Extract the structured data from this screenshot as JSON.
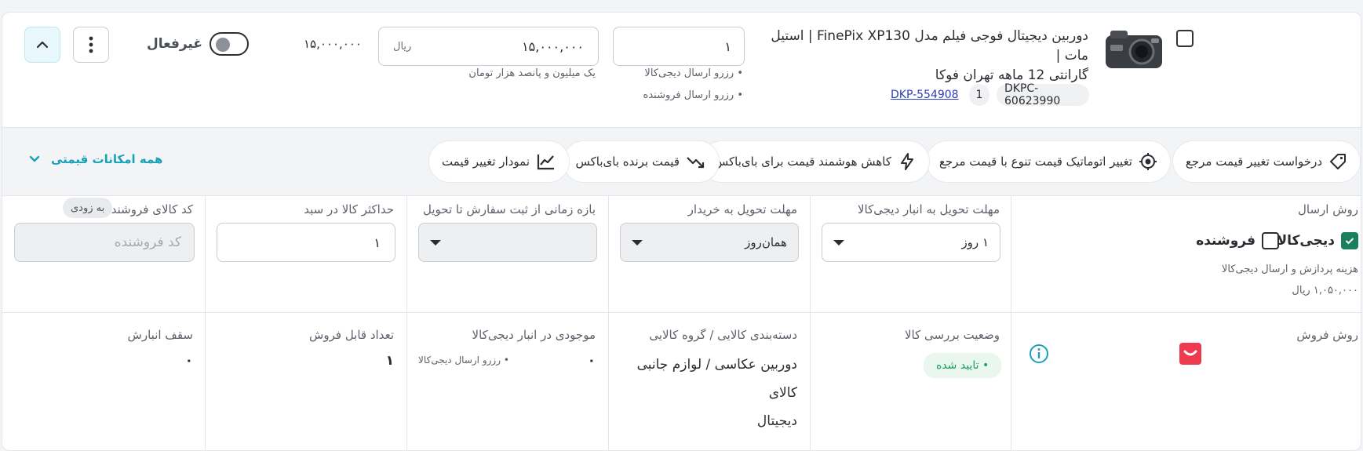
{
  "product": {
    "title_line1": "دوربین دیجیتال فوجی فیلم مدل FinePix XP130 | استیل مات |",
    "title_line2": "گارانتی 12 ماهه تهران فوکا",
    "dkpc": "DKPC-60623990",
    "qty_chip": "1",
    "dkp_link": "DKP-554908"
  },
  "stock": {
    "value": "۱",
    "note1": "• رزرو ارسال دیجی‌کالا",
    "note2": "• رزرو ارسال فروشنده"
  },
  "price": {
    "value": "۱۵,۰۰۰,۰۰۰",
    "currency": "ریال",
    "words": "یک میلیون و پانصد هزار تومان",
    "reference": "۱۵,۰۰۰,۰۰۰"
  },
  "status": {
    "label": "غیرفعال"
  },
  "pricing_bar": {
    "all_options": "همه امکانات قیمتی",
    "items": [
      {
        "label": "درخواست تغییر قیمت مرجع",
        "icon": "price-tag-icon"
      },
      {
        "label": "تغییر اتوماتیک قیمت تنوع با قیمت مرجع",
        "icon": "target-icon"
      },
      {
        "label": "کاهش هوشمند قیمت برای بای‌باکس",
        "icon": "bolt-icon"
      },
      {
        "label": "قیمت برنده بای‌باکس",
        "icon": "trend-down-icon"
      },
      {
        "label": "نمودار تغییر قیمت",
        "icon": "line-chart-icon"
      }
    ]
  },
  "shipping": {
    "method_label": "روش ارسال",
    "digikala": "دیجی‌کالا",
    "seller": "فروشنده",
    "fee_note": "هزینه پردازش و ارسال دیجی‌کالا ۱,۰۵۰,۰۰۰ ریال",
    "warehouse_deadline_label": "مهلت تحویل به انبار دیجی‌کالا",
    "warehouse_deadline_value": "۱ روز",
    "buyer_deadline_label": "مهلت تحویل به خریدار",
    "buyer_deadline_value": "همان‌روز",
    "interval_label": "بازه زمانی از ثبت سفارش تا تحویل",
    "max_cart_label": "حداکثر کالا در سبد",
    "max_cart_value": "۱",
    "seller_code_label": "کد کالای فروشنده",
    "soon_tag": "به زودی",
    "seller_code_placeholder": "کد فروشنده"
  },
  "sales": {
    "method_label": "روش فروش",
    "review_label": "وضعیت بررسی کالا",
    "review_status": "• تایید شده",
    "category_label": "دسته‌بندی کالایی / گروه کالایی",
    "category_line1": "دوربین عکاسی / لوازم جانبی کالای",
    "category_line2": "دیجیتال",
    "dk_stock_label": "موجودی در انبار دیجی‌کالا",
    "dk_stock_value": "۰",
    "dk_stock_note": "• رزرو ارسال دیجی‌کالا",
    "sellable_label": "تعداد قابل فروش",
    "sellable_value": "۱",
    "cap_label": "سقف انبارش",
    "cap_value": "۰"
  },
  "colors": {
    "primary_teal": "#17a2b8",
    "checked_green": "#1a7f5b",
    "brand_red": "#ef394e",
    "approved_green": "#1f9d60"
  }
}
